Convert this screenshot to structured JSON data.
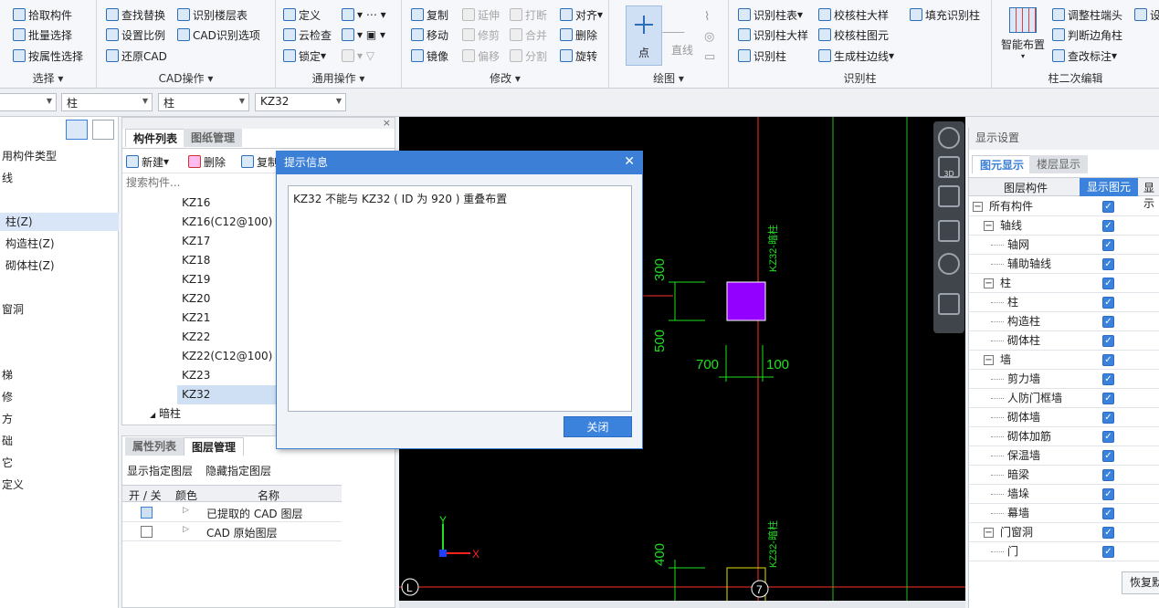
{
  "ribbon": {
    "groups": {
      "select": "选择",
      "cad": "CAD操作",
      "common": "通用操作",
      "modify": "修改",
      "draw": "绘图",
      "recog_col": "识别柱",
      "col_edit": "柱二次编辑"
    },
    "select": {
      "pick": "拾取构件",
      "batch": "批量选择",
      "byprop": "按属性选择"
    },
    "cad": {
      "find_replace": "查找替换",
      "set_scale": "设置比例",
      "restore": "还原CAD",
      "layer_table": "识别楼层表",
      "cad_options": "CAD识别选项"
    },
    "common": {
      "define": "定义",
      "cloud": "云检查",
      "lock": "锁定"
    },
    "modify": {
      "copy": "复制",
      "move": "移动",
      "mirror": "镜像",
      "extend": "延伸",
      "trim": "修剪",
      "offset": "偏移",
      "break": "打断",
      "merge": "合并",
      "split": "分割",
      "align": "对齐",
      "delete": "删除",
      "rotate": "旋转"
    },
    "draw": {
      "point": "点",
      "line": "直线"
    },
    "recog": {
      "col_table": "识别柱表",
      "col_detail": "识别柱大样",
      "col": "识别柱",
      "check_detail": "校核柱大样",
      "check_elem": "校核柱图元",
      "gen_edge": "生成柱边线",
      "fill": "填充识别柱"
    },
    "coledit": {
      "smart": "智能布置",
      "adjust_end": "调整柱端头",
      "judge_corner": "判断边角柱",
      "modify_label": "查改标注",
      "settings": "设"
    }
  },
  "combos": [
    "",
    "柱",
    "柱",
    "KZ32"
  ],
  "left_tree": [
    "用构件类型",
    "线",
    "柱(Z)",
    "构造柱(Z)",
    "砌体柱(Z)",
    "窗洞",
    "梯",
    "修",
    "方",
    "础",
    "它",
    "定义"
  ],
  "complist": {
    "tab_active": "构件列表",
    "tab_other": "图纸管理",
    "new": "新建",
    "delete": "删除",
    "copy": "复制",
    "search_placeholder": "搜索构件...",
    "items": [
      "KZ16",
      "KZ16(C12@100)",
      "KZ17",
      "KZ18",
      "KZ19",
      "KZ20",
      "KZ21",
      "KZ22",
      "KZ22(C12@100)",
      "KZ23",
      "KZ32"
    ],
    "group": "暗柱"
  },
  "dialog": {
    "title": "提示信息",
    "message": "KZ32 不能与 KZ32 ( ID 为 920 ) 重叠布置",
    "close": "关闭"
  },
  "layer": {
    "tab_other": "属性列表",
    "tab_active": "图层管理",
    "show_specified": "显示指定图层",
    "hide_specified": "隐藏指定图层",
    "headers": [
      "开 / 关",
      "颜色",
      "名称"
    ],
    "rows": [
      {
        "name": "已提取的 CAD 图层",
        "on": true
      },
      {
        "name": "CAD 原始图层",
        "on": false
      }
    ]
  },
  "cad": {
    "dims": [
      "300",
      "500",
      "700",
      "100",
      "400"
    ],
    "labels": [
      "KZ32-暗柱",
      "KZ32-暗柱"
    ],
    "axes": [
      "L",
      "7"
    ],
    "ucs": {
      "y": "Y",
      "x": "X"
    }
  },
  "display": {
    "title": "显示设置",
    "tab_active": "图元显示",
    "tab_other": "楼层显示",
    "headers": [
      "图层构件",
      "显示图元",
      "显示"
    ],
    "rows": [
      {
        "label": "所有构件",
        "level": 0,
        "pm": "-"
      },
      {
        "label": "轴线",
        "level": 1,
        "pm": "-"
      },
      {
        "label": "轴网",
        "level": 2,
        "pm": ""
      },
      {
        "label": "辅助轴线",
        "level": 2,
        "pm": ""
      },
      {
        "label": "柱",
        "level": 1,
        "pm": "-"
      },
      {
        "label": "柱",
        "level": 2,
        "pm": ""
      },
      {
        "label": "构造柱",
        "level": 2,
        "pm": ""
      },
      {
        "label": "砌体柱",
        "level": 2,
        "pm": ""
      },
      {
        "label": "墙",
        "level": 1,
        "pm": "-"
      },
      {
        "label": "剪力墙",
        "level": 2,
        "pm": ""
      },
      {
        "label": "人防门框墙",
        "level": 2,
        "pm": ""
      },
      {
        "label": "砌体墙",
        "level": 2,
        "pm": ""
      },
      {
        "label": "砌体加筋",
        "level": 2,
        "pm": ""
      },
      {
        "label": "保温墙",
        "level": 2,
        "pm": ""
      },
      {
        "label": "暗梁",
        "level": 2,
        "pm": ""
      },
      {
        "label": "墙垛",
        "level": 2,
        "pm": ""
      },
      {
        "label": "幕墙",
        "level": 2,
        "pm": ""
      },
      {
        "label": "门窗洞",
        "level": 1,
        "pm": "-"
      },
      {
        "label": "门",
        "level": 2,
        "pm": ""
      }
    ],
    "restore": "恢复默"
  },
  "viewtool": {
    "label_3d": "3D"
  }
}
